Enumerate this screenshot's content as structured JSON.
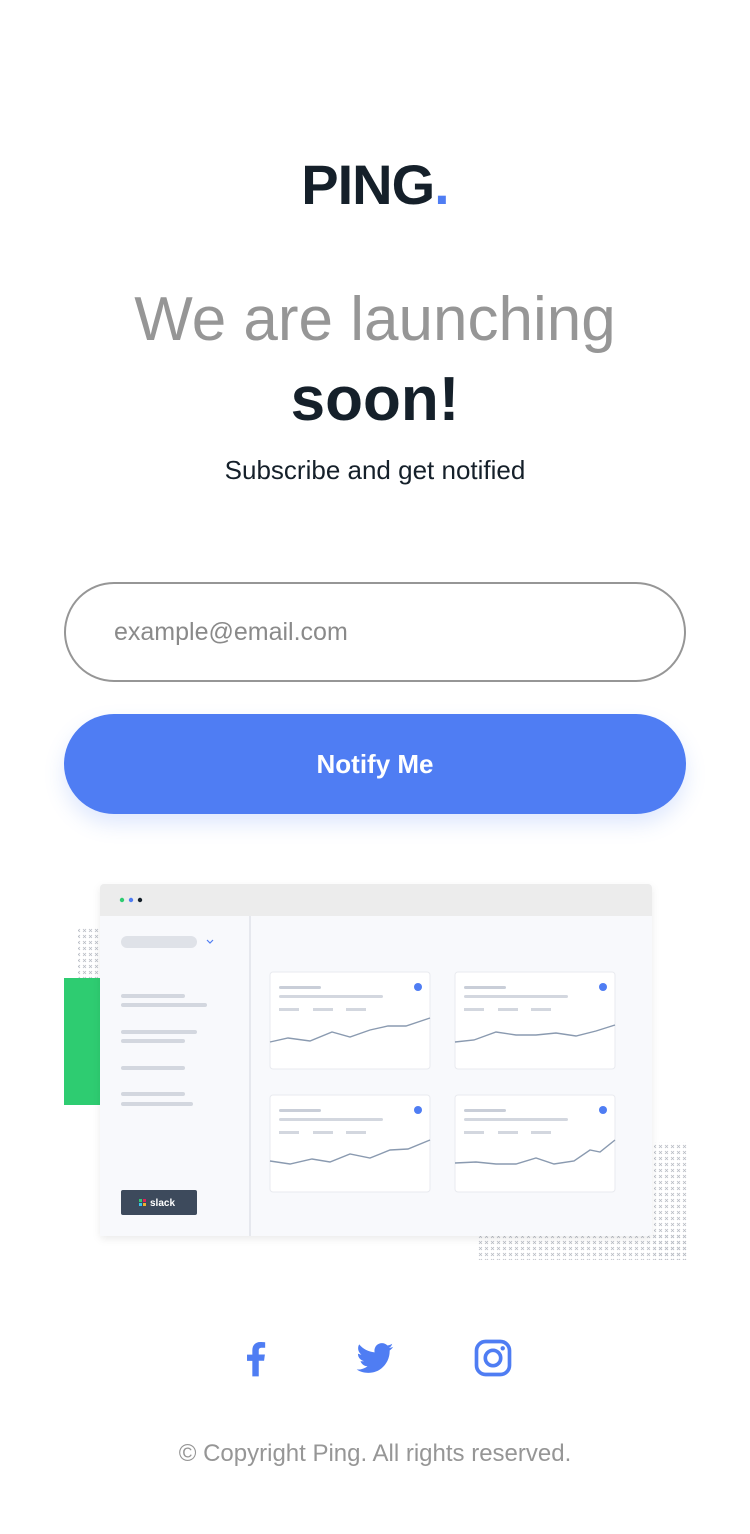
{
  "brand": {
    "name": "PING",
    "dot": ".",
    "accent": "#4f7df3",
    "dark": "#15202a"
  },
  "hero": {
    "line1": "We are launching",
    "line2": "soon!",
    "subtitle": "Subscribe and get notified"
  },
  "form": {
    "email_placeholder": "example@email.com",
    "email_value": "",
    "submit_label": "Notify Me"
  },
  "illustration": {
    "sidebar_logo": "slack",
    "green_accent": "#2ecc71"
  },
  "social": [
    {
      "name": "facebook",
      "icon": "facebook-icon"
    },
    {
      "name": "twitter",
      "icon": "twitter-icon"
    },
    {
      "name": "instagram",
      "icon": "instagram-icon"
    }
  ],
  "footer": {
    "copyright": "© Copyright Ping. All rights reserved."
  }
}
